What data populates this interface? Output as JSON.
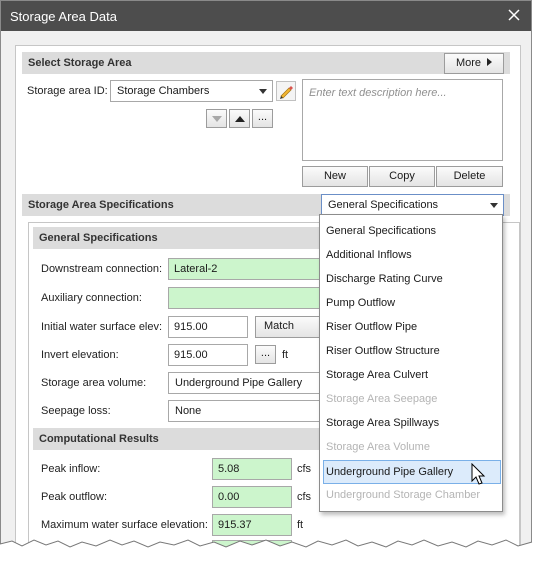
{
  "window": {
    "title": "Storage Area Data"
  },
  "select_section": {
    "header": "Select Storage Area",
    "more_button": "More",
    "id_label": "Storage area ID:",
    "id_value": "Storage Chambers",
    "description_placeholder": "Enter text description here...",
    "nav_more": "...",
    "buttons": {
      "new": "New",
      "copy": "Copy",
      "delete": "Delete"
    }
  },
  "specs_section": {
    "header": "Storage Area Specifications",
    "selector_value": "General Specifications"
  },
  "general": {
    "header": "General Specifications",
    "downstream_label": "Downstream connection:",
    "downstream_value": "Lateral-2",
    "auxiliary_label": "Auxiliary connection:",
    "auxiliary_value": "",
    "initial_wse_label": "Initial water surface elev:",
    "initial_wse_value": "915.00",
    "match_invert_button": "Match Invert",
    "invert_label": "Invert elevation:",
    "invert_value": "915.00",
    "invert_browse": "...",
    "invert_unit": "ft",
    "volume_label": "Storage area volume:",
    "volume_value": "Underground Pipe Gallery",
    "seepage_label": "Seepage loss:",
    "seepage_value": "None"
  },
  "results": {
    "header": "Computational Results",
    "peak_inflow_label": "Peak inflow:",
    "peak_inflow_value": "5.08",
    "peak_inflow_unit": "cfs",
    "peak_outflow_label": "Peak outflow:",
    "peak_outflow_value": "0.00",
    "peak_outflow_unit": "cfs",
    "max_wse_label": "Maximum water surface elevation:",
    "max_wse_value": "915.37",
    "max_wse_unit": "ft"
  },
  "dropdown": {
    "items": [
      {
        "label": "General Specifications",
        "state": "enabled"
      },
      {
        "label": "Additional Inflows",
        "state": "enabled"
      },
      {
        "label": "Discharge Rating Curve",
        "state": "enabled"
      },
      {
        "label": "Pump Outflow",
        "state": "enabled"
      },
      {
        "label": "Riser Outflow Pipe",
        "state": "enabled"
      },
      {
        "label": "Riser Outflow Structure",
        "state": "enabled"
      },
      {
        "label": "Storage Area Culvert",
        "state": "enabled"
      },
      {
        "label": "Storage Area Seepage",
        "state": "disabled"
      },
      {
        "label": "Storage Area Spillways",
        "state": "enabled"
      },
      {
        "label": "Storage Area Volume",
        "state": "disabled"
      },
      {
        "label": "Underground Pipe Gallery",
        "state": "hover"
      },
      {
        "label": "Underground Storage Chamber",
        "state": "disabled"
      }
    ]
  },
  "colors": {
    "titlebar": "#4d4d4d",
    "section_header": "#dcdcdc",
    "computed_field": "#ccf5cc",
    "hover_item": "#dcebfb",
    "disabled_text": "#b4b4b4"
  }
}
